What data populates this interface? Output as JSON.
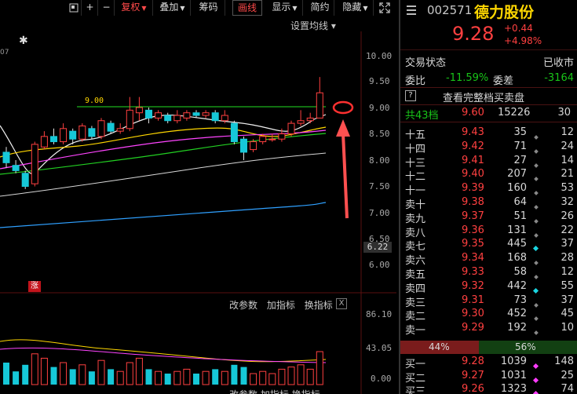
{
  "toolbar": {
    "buttons": [
      "+",
      "−",
      "复权",
      "叠加",
      "筹码",
      "画线",
      "显示",
      "简约",
      "隐藏"
    ],
    "expand_icon": "expand-icon"
  },
  "chart": {
    "ma_settings": "设置均线 ▾",
    "star": "✱",
    "tiny_label": "07",
    "y_ticks": [
      "10.00",
      "9.50",
      "9.00",
      "8.50",
      "8.00",
      "7.50",
      "7.00",
      "6.50",
      "6.00"
    ],
    "current_price_tag": "6.22",
    "hline_label": "9.00",
    "zhang_badge": "涨",
    "sub_tools": [
      "改参数",
      "加指标",
      "换指标"
    ],
    "sub_close": "X",
    "volume_ticks": [
      "86.10",
      "43.05",
      "0.00"
    ],
    "accent_red": "#ff4040",
    "accent_green": "#18c418"
  },
  "chart_data": {
    "type": "candlestick",
    "ylim": [
      6.0,
      10.0
    ],
    "candles": [
      {
        "o": 8.15,
        "c": 7.95,
        "h": 8.25,
        "l": 7.85
      },
      {
        "o": 7.9,
        "c": 7.8,
        "h": 8.0,
        "l": 7.75
      },
      {
        "o": 7.75,
        "c": 7.5,
        "h": 7.8,
        "l": 7.45
      },
      {
        "o": 7.55,
        "c": 8.3,
        "h": 8.35,
        "l": 7.5
      },
      {
        "o": 8.25,
        "c": 8.45,
        "h": 8.55,
        "l": 8.2
      },
      {
        "o": 8.45,
        "c": 8.35,
        "h": 8.6,
        "l": 8.3
      },
      {
        "o": 8.35,
        "c": 8.6,
        "h": 8.7,
        "l": 8.3
      },
      {
        "o": 8.55,
        "c": 8.4,
        "h": 8.6,
        "l": 8.3
      },
      {
        "o": 8.4,
        "c": 8.65,
        "h": 8.7,
        "l": 8.35
      },
      {
        "o": 8.6,
        "c": 8.45,
        "h": 8.65,
        "l": 8.4
      },
      {
        "o": 8.45,
        "c": 8.75,
        "h": 8.8,
        "l": 8.4
      },
      {
        "o": 8.7,
        "c": 8.55,
        "h": 8.75,
        "l": 8.5
      },
      {
        "o": 8.55,
        "c": 8.6,
        "h": 8.7,
        "l": 8.5
      },
      {
        "o": 8.6,
        "c": 8.95,
        "h": 9.2,
        "l": 8.55
      },
      {
        "o": 8.9,
        "c": 9.0,
        "h": 9.2,
        "l": 8.75
      },
      {
        "o": 8.95,
        "c": 8.8,
        "h": 9.0,
        "l": 8.7
      },
      {
        "o": 8.8,
        "c": 8.9,
        "h": 8.95,
        "l": 8.75
      },
      {
        "o": 8.85,
        "c": 8.75,
        "h": 8.9,
        "l": 8.7
      },
      {
        "o": 8.75,
        "c": 8.85,
        "h": 8.95,
        "l": 8.7
      },
      {
        "o": 8.8,
        "c": 8.9,
        "h": 8.95,
        "l": 8.75
      },
      {
        "o": 8.9,
        "c": 8.85,
        "h": 8.95,
        "l": 8.8
      },
      {
        "o": 8.85,
        "c": 8.9,
        "h": 8.95,
        "l": 8.8
      },
      {
        "o": 8.9,
        "c": 8.75,
        "h": 8.95,
        "l": 8.7
      },
      {
        "o": 8.75,
        "c": 8.85,
        "h": 8.95,
        "l": 8.7
      },
      {
        "o": 8.7,
        "c": 8.35,
        "h": 8.75,
        "l": 8.3
      },
      {
        "o": 8.4,
        "c": 8.15,
        "h": 8.45,
        "l": 8.0
      },
      {
        "o": 8.2,
        "c": 8.35,
        "h": 8.4,
        "l": 8.15
      },
      {
        "o": 8.35,
        "c": 8.45,
        "h": 8.5,
        "l": 8.3
      },
      {
        "o": 8.4,
        "c": 8.4,
        "h": 8.5,
        "l": 8.35
      },
      {
        "o": 8.4,
        "c": 8.5,
        "h": 8.6,
        "l": 8.35
      },
      {
        "o": 8.5,
        "c": 8.7,
        "h": 8.75,
        "l": 8.45
      },
      {
        "o": 8.7,
        "c": 8.75,
        "h": 8.95,
        "l": 8.65
      },
      {
        "o": 8.75,
        "c": 8.8,
        "h": 8.9,
        "l": 8.7
      },
      {
        "o": 8.8,
        "c": 9.28,
        "h": 9.58,
        "l": 8.8
      }
    ],
    "volumes": [
      20,
      12,
      18,
      28,
      24,
      16,
      20,
      14,
      18,
      12,
      22,
      14,
      12,
      20,
      24,
      14,
      12,
      10,
      12,
      14,
      10,
      12,
      14,
      12,
      18,
      16,
      10,
      12,
      10,
      14,
      16,
      18,
      14,
      30
    ]
  },
  "quote": {
    "code": "002571",
    "name": "德力股份",
    "price": "9.28",
    "change": "+0.44",
    "change_pct": "+4.98%",
    "status_label": "交易状态",
    "status_value": "已收市",
    "weibi_label": "委比",
    "weibi_value": "-11.59%",
    "weicha_label": "委差",
    "weicha_value": "-3164",
    "help_mark": "?",
    "full_book": "查看完整档买卖盘",
    "total_label": "共43档",
    "total_price": "9.60",
    "total_vol": "15226",
    "total_cnt": "30",
    "asks": [
      {
        "label": "十五",
        "price": "9.43",
        "vol": "35",
        "dot": "gray",
        "cnt": "12"
      },
      {
        "label": "十四",
        "price": "9.42",
        "vol": "71",
        "dot": "gray",
        "cnt": "24"
      },
      {
        "label": "十三",
        "price": "9.41",
        "vol": "27",
        "dot": "gray",
        "cnt": "14"
      },
      {
        "label": "十二",
        "price": "9.40",
        "vol": "207",
        "dot": "gray",
        "cnt": "21"
      },
      {
        "label": "十一",
        "price": "9.39",
        "vol": "160",
        "dot": "gray",
        "cnt": "53"
      },
      {
        "label": "卖十",
        "price": "9.38",
        "vol": "64",
        "dot": "gray",
        "cnt": "32"
      },
      {
        "label": "卖九",
        "price": "9.37",
        "vol": "51",
        "dot": "gray",
        "cnt": "26"
      },
      {
        "label": "卖八",
        "price": "9.36",
        "vol": "131",
        "dot": "gray",
        "cnt": "22"
      },
      {
        "label": "卖七",
        "price": "9.35",
        "vol": "445",
        "dot": "cyan",
        "cnt": "37"
      },
      {
        "label": "卖六",
        "price": "9.34",
        "vol": "168",
        "dot": "gray",
        "cnt": "28"
      },
      {
        "label": "卖五",
        "price": "9.33",
        "vol": "58",
        "dot": "gray",
        "cnt": "12"
      },
      {
        "label": "卖四",
        "price": "9.32",
        "vol": "442",
        "dot": "cyan",
        "cnt": "55"
      },
      {
        "label": "卖三",
        "price": "9.31",
        "vol": "73",
        "dot": "gray",
        "cnt": "37"
      },
      {
        "label": "卖二",
        "price": "9.30",
        "vol": "452",
        "dot": "gray",
        "cnt": "45"
      },
      {
        "label": "卖一",
        "price": "9.29",
        "vol": "192",
        "dot": "gray",
        "cnt": "10"
      }
    ],
    "ratio_sell": "44%",
    "ratio_buy": "56%",
    "ratio_sell_value": 0.44,
    "bids": [
      {
        "label": "买一",
        "price": "9.28",
        "vol": "1039",
        "dot": "mag",
        "cnt": "148"
      },
      {
        "label": "买二",
        "price": "9.27",
        "vol": "1031",
        "dot": "mag",
        "cnt": "25"
      },
      {
        "label": "买三",
        "price": "9.26",
        "vol": "1323",
        "dot": "mag",
        "cnt": "74"
      }
    ]
  }
}
